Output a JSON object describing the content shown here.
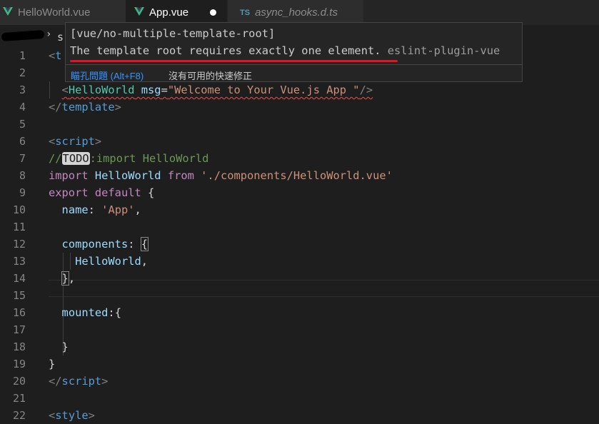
{
  "tabs": [
    {
      "label": "HelloWorld.vue"
    },
    {
      "label": "App.vue"
    },
    {
      "label": "async_hooks.d.ts",
      "badge": "TS"
    }
  ],
  "breadcrumb": {
    "separator": "›",
    "visible_text": "s"
  },
  "line_numbers": [
    "1",
    "2",
    "3",
    "4",
    "5",
    "6",
    "7",
    "8",
    "9",
    "10",
    "11",
    "12",
    "13",
    "14",
    "15",
    "16",
    "17",
    "18",
    "19",
    "20",
    "21",
    "22"
  ],
  "code": {
    "l1_open": "<",
    "l1_tag": "t",
    "l3_indent": "  ",
    "l3_open": "<",
    "l3_comp": "HelloWorld",
    "l3_attr": " msg",
    "l3_eq": "=",
    "l3_val": "\"Welcome to Your Vue.js App \"",
    "l3_close": "/>",
    "l4_open": "</",
    "l4_tag": "template",
    "l4_close": ">",
    "l6_open": "<",
    "l6_tag": "script",
    "l6_close": ">",
    "l7_slashes": "//",
    "l7_todo": "TODO",
    "l7_rest": ":import HelloWorld",
    "l8_import": "import",
    "l8_name": " HelloWorld ",
    "l8_from": "from",
    "l8_path": " './components/HelloWorld.vue'",
    "l9_export": "export",
    "l9_default": " default",
    "l9_brace": " {",
    "l10_indent": "  ",
    "l10_key": "name",
    "l10_colon": ": ",
    "l10_val": "'App'",
    "l10_comma": ",",
    "l12_indent": "  ",
    "l12_key": "components",
    "l12_colon": ": ",
    "l12_brace": "{",
    "l13_indent": "    ",
    "l13_name": "HelloWorld",
    "l13_comma": ",",
    "l14_indent": "  ",
    "l14_brace": "}",
    "l14_comma": ",",
    "l16_indent": "  ",
    "l16_key": "mounted",
    "l16_rest": ":{",
    "l18_text": "  }",
    "l19_text": "}",
    "l20_open": "</",
    "l20_tag": "script",
    "l20_close": ">",
    "l22_open": "<",
    "l22_tag": "style",
    "l22_close": ">"
  },
  "hover": {
    "rule": "[vue/no-multiple-template-root]",
    "message": "The template root requires exactly one element.",
    "source": " eslint-plugin-vue",
    "peek_problem": "瞄孔問題 (Alt+F8)",
    "no_quick_fix": "沒有可用的快速修正"
  },
  "colors": {
    "background": "#1e1e1e",
    "tag": "#569cd6",
    "component": "#4ec9b0",
    "string": "#ce9178",
    "keyword": "#c586c0",
    "error_underline": "#e81123",
    "vue_logo": "#41b883",
    "link": "#3794ff"
  },
  "icons": [
    "vue-logo-icon",
    "ts-file-icon",
    "unsaved-dot-icon",
    "chevron-right-icon"
  ]
}
